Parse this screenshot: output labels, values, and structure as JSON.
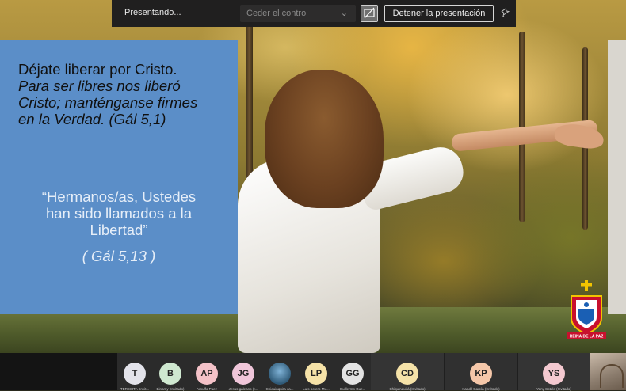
{
  "toolbar": {
    "presenting_label": "Presentando...",
    "control_placeholder": "Ceder el control",
    "stop_label": "Detener la presentación"
  },
  "slide": {
    "title_lines": [
      "Déjate liberar por Cristo.",
      "Para ser libres nos liberó",
      "Cristo; manténganse firmes",
      "en la Verdad. (Gál 5,1)"
    ],
    "quote_lines": [
      "“Hermanos/as,  Ustedes",
      "han sido llamados a la",
      "Libertad”"
    ],
    "quote_ref": "( Gál 5,13 )",
    "logo_text": "REINA DE LA PAZ"
  },
  "participants": [
    {
      "initials": "T",
      "name": "TERESITA (Invit...",
      "color": "#e3e3ea"
    },
    {
      "initials": "B",
      "name": "Binamy (Invitado)",
      "color": "#cfe8d0"
    },
    {
      "initials": "AP",
      "name": "Arnulfo Paez",
      "color": "#f4c2c8"
    },
    {
      "initials": "JG",
      "name": "Jesus galeano (I...",
      "color": "#f0c6da"
    },
    {
      "initials": "",
      "name": "Chiquinquira ca...",
      "color": "#3a6a8a",
      "icon": "church-photo-icon"
    },
    {
      "initials": "LP",
      "name": "Luis botero Mu...",
      "color": "#f5e2a8"
    },
    {
      "initials": "GG",
      "name": "Guillermo Gue...",
      "color": "#e3e3e3"
    },
    {
      "initials": "CD",
      "name": "Chiquinquirá (Invitado)",
      "color": "#f5e2a8"
    },
    {
      "initials": "KP",
      "name": "Kandil García (Invitado)",
      "color": "#f5c7a9"
    },
    {
      "initials": "YS",
      "name": "Yeny Sotelo (Invitado)",
      "color": "#f4c9d0"
    }
  ]
}
